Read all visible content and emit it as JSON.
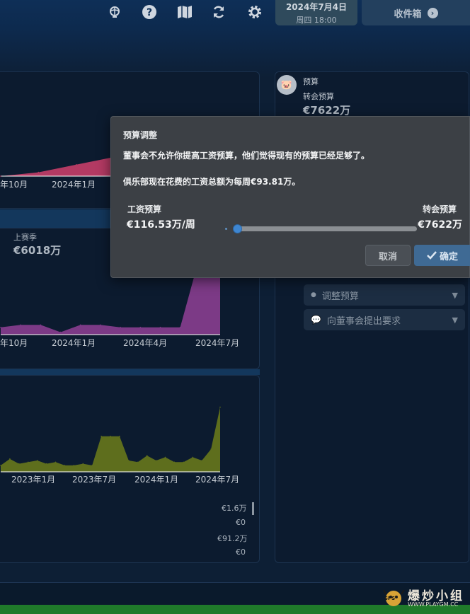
{
  "topbar": {
    "icons": [
      "globe-icon",
      "help-icon",
      "map-icon",
      "refresh-icon",
      "gear-icon"
    ],
    "date": "2024年7月4日",
    "day_time": "周四 18:00",
    "inbox_label": "收件箱"
  },
  "chart_top": {
    "tick_labels": [
      "年10月",
      "2024年1月"
    ]
  },
  "chart_mid": {
    "series_label": "上赛季",
    "value": "€6018万",
    "tick_labels": [
      "年10月",
      "2024年1月",
      "2024年4月",
      "2024年7月"
    ]
  },
  "chart_bottom": {
    "tick_labels": [
      "2023年1月",
      "2023年7月",
      "2024年1月",
      "2024年7月"
    ],
    "side_values": [
      "€1.6万",
      "€0",
      "€91.2万",
      "€0"
    ]
  },
  "chart_data": [
    {
      "type": "area",
      "x": [
        "2023-07",
        "2023-10",
        "2024-01",
        "2024-02"
      ],
      "series": [
        {
          "values": [
            0,
            0.2,
            0.6,
            1.0
          ]
        }
      ],
      "color": "#b33a63"
    },
    {
      "type": "area",
      "x": [
        "2023-08",
        "2023-09",
        "2023-10",
        "2023-11",
        "2023-12",
        "2024-01",
        "2024-02",
        "2024-03",
        "2024-04",
        "2024-05",
        "2024-06",
        "2024-07"
      ],
      "series": [
        {
          "values": [
            3,
            4,
            4,
            1,
            4,
            4,
            3,
            3,
            3,
            3,
            33,
            26
          ]
        }
      ],
      "color": "#7c3a86"
    },
    {
      "type": "area",
      "x": [
        "2022-07",
        "2022-08",
        "2022-09",
        "2022-10",
        "2022-11",
        "2022-12",
        "2023-01",
        "2023-02",
        "2023-03",
        "2023-04",
        "2023-05",
        "2023-06",
        "2023-07",
        "2023-08",
        "2023-09",
        "2023-10",
        "2023-11",
        "2023-12",
        "2024-01",
        "2024-02",
        "2024-03",
        "2024-04",
        "2024-05",
        "2024-06",
        "2024-07"
      ],
      "series": [
        {
          "values": [
            4,
            8,
            5,
            6,
            7,
            5,
            6,
            4,
            4,
            5,
            4,
            22,
            22,
            22,
            7,
            6,
            10,
            7,
            9,
            6,
            6,
            9,
            7,
            14,
            40
          ]
        }
      ],
      "color": "#5e6e1d"
    }
  ],
  "budget_panel": {
    "title": "预算",
    "transfer_label": "转会预算",
    "transfer_value": "€7622万",
    "adjust_label": "调整预算",
    "request_label": "向董事会提出要求"
  },
  "dialog": {
    "title": "预算调整",
    "message1": "董事会不允许你提高工资预算，他们觉得现有的预算已经足够了。",
    "message2": "俱乐部现在花费的工资总额为每周€93.81万。",
    "wage_label": "工资预算",
    "wage_value": "€116.53万/周",
    "transfer_label": "转会预算",
    "transfer_value": "€7622万",
    "slider_fraction": 0.0,
    "cancel_label": "取消",
    "ok_label": "确定"
  },
  "watermark": {
    "text": "爆炒小组",
    "url": "WWW.PLAYGM.CC",
    "badge": "SPS"
  }
}
